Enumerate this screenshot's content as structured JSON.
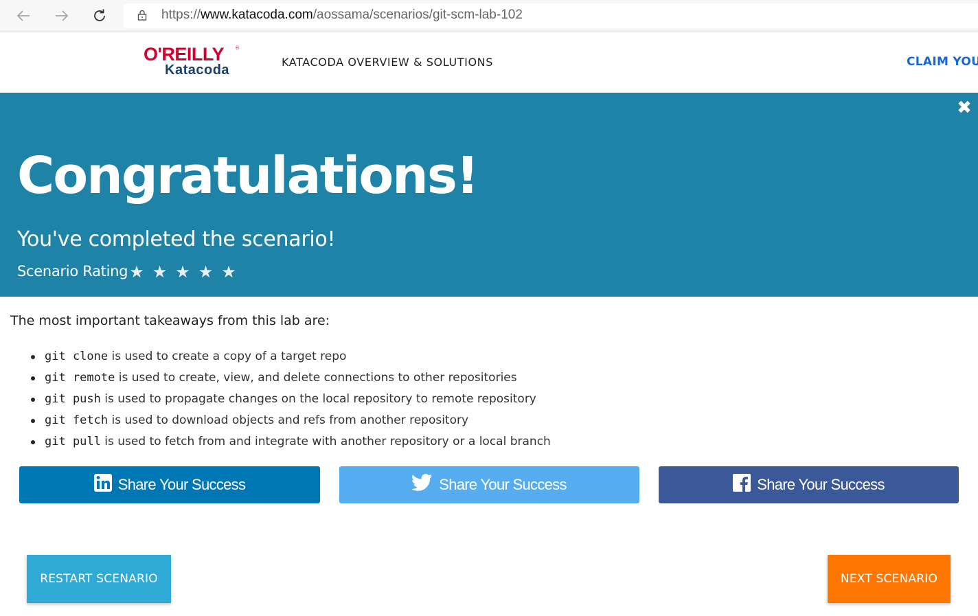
{
  "browser": {
    "url_scheme": "https://",
    "url_host": "www.katacoda.com",
    "url_path": "/aossama/scenarios/git-scm-lab-102",
    "back_icon": "arrow-left-icon",
    "forward_icon": "arrow-right-icon",
    "reload_icon": "reload-icon",
    "lock_icon": "lock-icon"
  },
  "header": {
    "logo_top": "O'REILLY",
    "logo_registered": "®",
    "logo_bottom": "Katacoda",
    "nav_overview": "KATACODA OVERVIEW & SOLUTIONS",
    "nav_claim": "CLAIM YOUR"
  },
  "banner": {
    "background": "#1e83a6",
    "title": "Congratulations!",
    "subtitle": "You've completed the scenario!",
    "rating_label": "Scenario Rating",
    "rating_max": 5,
    "close_icon": "close-icon"
  },
  "content": {
    "intro": "The most important takeaways from this lab are:",
    "takeaways": [
      {
        "code": "git clone",
        "text": " is used to create a copy of a target repo"
      },
      {
        "code": "git remote",
        "text": " is used to create, view, and delete connections to other repositories"
      },
      {
        "code": "git push",
        "text": " is used to propagate changes on the local repository to remote repository"
      },
      {
        "code": "git fetch",
        "text": " is used to download objects and refs from another repository"
      },
      {
        "code": "git pull",
        "text": " is used to fetch from and integrate with another repository or a local branch"
      }
    ]
  },
  "share": {
    "linkedin": {
      "label": "Share Your Success",
      "icon": "linkedin-icon",
      "color": "#0077b5"
    },
    "twitter": {
      "label": "Share Your Success",
      "icon": "twitter-icon",
      "color": "#55acee"
    },
    "facebook": {
      "label": "Share Your Success",
      "icon": "facebook-icon",
      "color": "#3b5998"
    }
  },
  "actions": {
    "restart_label": "RESTART SCENARIO",
    "next_label": "NEXT SCENARIO",
    "restart_color": "#2fa9d6",
    "next_color": "#ff7700"
  }
}
